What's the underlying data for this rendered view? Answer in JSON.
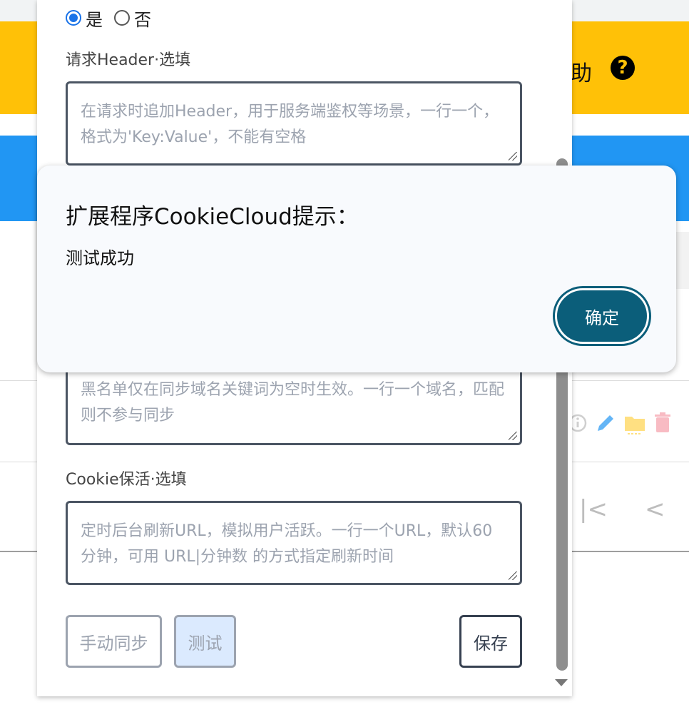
{
  "background": {
    "help_text": "助",
    "help_icon": "?",
    "colors": {
      "banner": "#ffc107",
      "toolbar": "#2196f3"
    },
    "row_icons": [
      "info-icon",
      "pencil-icon",
      "folder-icon",
      "trash-icon"
    ],
    "pager": {
      "first": "|<",
      "prev": "<"
    }
  },
  "panel": {
    "radio": {
      "yes": "是",
      "no": "否",
      "selected": "yes"
    },
    "header": {
      "label": "请求Header·选填",
      "placeholder": "在请求时追加Header，用于服务端鉴权等场景，一行一个，格式为'Key:Value'，不能有空格"
    },
    "blacklist": {
      "placeholder": "黑名单仅在同步域名关键词为空时生效。一行一个域名，匹配则不参与同步"
    },
    "keepalive": {
      "label": "Cookie保活·选填",
      "placeholder": "定时后台刷新URL，模拟用户活跃。一行一个URL，默认60分钟，可用 URL|分钟数 的方式指定刷新时间"
    },
    "buttons": {
      "manual_sync": "手动同步",
      "test": "测试",
      "save": "保存"
    }
  },
  "dialog": {
    "title": "扩展程序CookieCloud提示：",
    "message": "测试成功",
    "ok": "确定"
  }
}
